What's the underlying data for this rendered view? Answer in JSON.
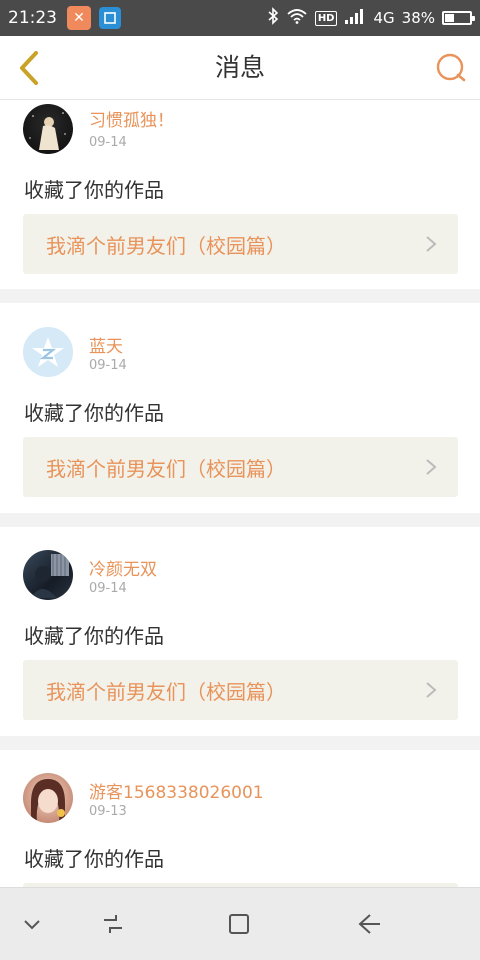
{
  "status_bar": {
    "time": "21:23",
    "network": "4G",
    "hd": "HD",
    "battery_percent": "38%",
    "battery_level": 0.38
  },
  "header": {
    "title": "消息"
  },
  "items": [
    {
      "user": "习惯孤独！",
      "date": "09-14",
      "action": "收藏了你的作品",
      "work_title": "我滴个前男友们（校园篇）"
    },
    {
      "user": "蓝天",
      "date": "09-14",
      "action": "收藏了你的作品",
      "work_title": "我滴个前男友们（校园篇）"
    },
    {
      "user": "冷颜无双",
      "date": "09-14",
      "action": "收藏了你的作品",
      "work_title": "我滴个前男友们（校园篇）"
    },
    {
      "user": "游客1568338026001",
      "date": "09-13",
      "action": "收藏了你的作品",
      "work_title": ""
    }
  ],
  "colors": {
    "accent": "#e8935a",
    "back_icon": "#c9a227",
    "link_background": "#f3f2ea",
    "status_bar": "#4a4a4a"
  }
}
